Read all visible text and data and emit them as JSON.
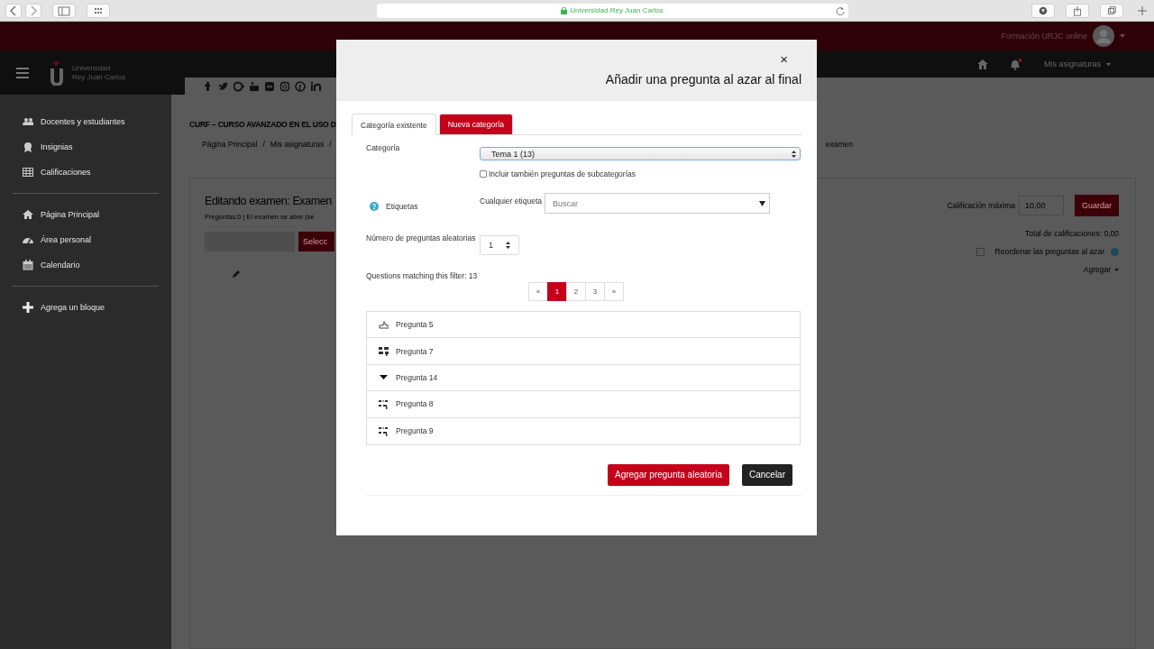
{
  "browser": {
    "url": "Universidad Rey Juan Carlos"
  },
  "top_bar": {
    "user_name": "Formación URJC online"
  },
  "navbar": {
    "logo_line_1": "Universidad",
    "logo_line_2": "Rey Juan Carlos",
    "menu_label": "Mis asignaturas"
  },
  "sidebar": {
    "sections": [
      {
        "items": [
          {
            "label": "Docentes y estudiantes",
            "kind": "users"
          },
          {
            "label": "Insignias",
            "kind": "badge"
          },
          {
            "label": "Calificaciones",
            "kind": "grid"
          }
        ]
      },
      {
        "items": [
          {
            "label": "Página Principal",
            "kind": "home"
          },
          {
            "label": "Área personal",
            "kind": "gauge"
          },
          {
            "label": "Calendario",
            "kind": "calendar"
          }
        ]
      },
      {
        "items": [
          {
            "label": "Agrega un bloque",
            "kind": "plus"
          }
        ]
      }
    ]
  },
  "page": {
    "course_title": "CURF – CURSO AVANZADO EN EL USO D",
    "breadcrumb": [
      "Página Principal",
      "Mis asignaturas"
    ],
    "breadcrumb_separators": [
      "/",
      "/"
    ],
    "breadcrumb_tail": "examen",
    "card": {
      "title": "Editando examen: Examen",
      "info": "Preguntas:0 | El examen se abre (se",
      "select_button": "Selecc",
      "max_grade_label": "Calificación máxima",
      "max_grade_value": "10,00",
      "save_button": "Guardar",
      "total": "Total de calificaciones: 0,00",
      "shuffle": {
        "label": "Reordenar las preguntas al azar",
        "checked": false
      },
      "add_menu": "Agregar"
    }
  },
  "modal": {
    "close": "×",
    "title": "Añadir una pregunta al azar al final",
    "tabs": [
      {
        "label": "Categoría existente",
        "selected": true
      },
      {
        "label": "Nueva categoría",
        "selected": false
      }
    ],
    "category_label": "Categoría",
    "category_value": "Tema 1 (13)",
    "include_subcategories": {
      "label": "Incluir también preguntas de subcategorías",
      "checked": false
    },
    "tags_label": "Etiquetas",
    "tags_sublabel": "Cualquier etiqueta",
    "tags_placeholder": "Buscar",
    "count_label": "Número de preguntas aleatorias",
    "count_value": "1",
    "matching": "Questions matching this filter: 13",
    "pagination": [
      {
        "label": "«",
        "selected": false
      },
      {
        "label": "1",
        "selected": true
      },
      {
        "label": "2",
        "selected": false
      },
      {
        "label": "3",
        "selected": false
      },
      {
        "label": "»",
        "selected": false
      }
    ],
    "questions": [
      {
        "name": "Pregunta 5",
        "kind": "marker"
      },
      {
        "name": "Pregunta 7",
        "kind": "blocks"
      },
      {
        "name": "Pregunta 14",
        "kind": "dropdown"
      },
      {
        "name": "Pregunta 8",
        "kind": "formula"
      },
      {
        "name": "Pregunta 9",
        "kind": "formula"
      }
    ],
    "primary_button": "Agregar pregunta aleatoria",
    "secondary_button": "Cancelar"
  }
}
